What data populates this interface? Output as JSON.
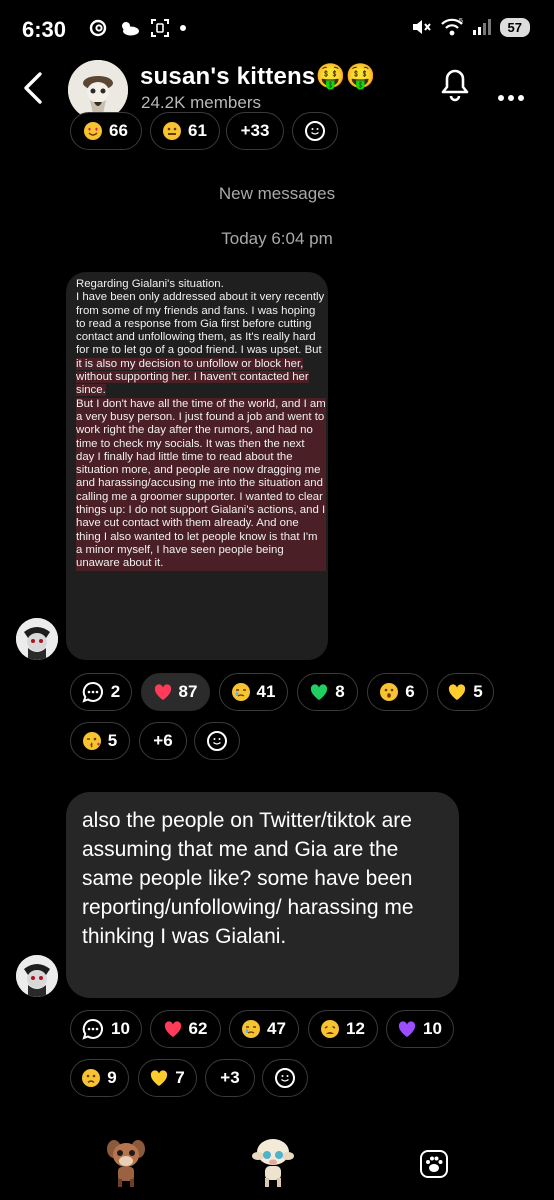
{
  "status_bar": {
    "time": "6:30",
    "battery": "57",
    "network_badge": "5"
  },
  "header": {
    "title": "susan's kittens🤑🤑",
    "members": "24.2K members",
    "icons": [
      "back-icon",
      "bell-icon",
      "more-icon"
    ]
  },
  "top_reactions": [
    {
      "emoji": "heart-eyes",
      "count": "66"
    },
    {
      "emoji": "grimace",
      "count": "61"
    },
    {
      "emoji": "",
      "count": "+33"
    }
  ],
  "dividers": {
    "new_messages": "New messages",
    "timestamp": "Today 6:04 pm"
  },
  "message1": {
    "image_text": {
      "p1": "Regarding Gialani's situation.",
      "p2a": "I have been only addressed about it very recently from some of my friends and fans. I was hoping to read a response from Gia first before cutting contact and unfollowing them, as It's really hard for me to let go of a good friend. I was upset. But ",
      "p2b": "it is also my decision to unfollow or block her, without supporting her. I haven't contacted her since.",
      "p3": "But I don't have all the time of the world, and I am a very busy person. I just found a job and went to work right the day after the rumors, and had no time to check my socials. It was then the next day I finally had little time to read about the situation more, and people are now dragging me and harassing/accusing me into the situation and calling me a groomer supporter. I wanted to clear things up: I do not support Gialani's actions, and I have cut contact with them already. And one thing I also wanted to let people know is that I'm a minor myself, I have seen people being unaware about it."
    },
    "reactions": [
      {
        "type": "reply",
        "count": "2"
      },
      {
        "type": "heart",
        "count": "87"
      },
      {
        "type": "tear",
        "count": "41"
      },
      {
        "type": "green-heart",
        "count": "8"
      },
      {
        "type": "hushed",
        "count": "6"
      },
      {
        "type": "yellow-heart",
        "count": "5"
      },
      {
        "type": "kiss",
        "count": "5"
      },
      {
        "type": "more",
        "count": "+6"
      }
    ]
  },
  "message2": {
    "text": "also the people on Twitter/tiktok are assuming that me and Gia are the same people like? some have been reporting/unfollowing/ harassing me thinking I was Gialani.",
    "reactions": [
      {
        "type": "reply",
        "count": "10"
      },
      {
        "type": "heart",
        "count": "62"
      },
      {
        "type": "tear",
        "count": "47"
      },
      {
        "type": "weary",
        "count": "12"
      },
      {
        "type": "purple-heart",
        "count": "10"
      },
      {
        "type": "frown",
        "count": "9"
      },
      {
        "type": "yellow-heart",
        "count": "7"
      },
      {
        "type": "more",
        "count": "+3"
      }
    ]
  },
  "colors": {
    "background": "#000000",
    "bubble": "#262626",
    "chip_border": "#3a3a3a",
    "highlight": "#4a2026",
    "heart": "#ff3b5c",
    "green": "#1fcf62",
    "purple": "#9b4dff",
    "yellow": "#ffcc2e"
  }
}
